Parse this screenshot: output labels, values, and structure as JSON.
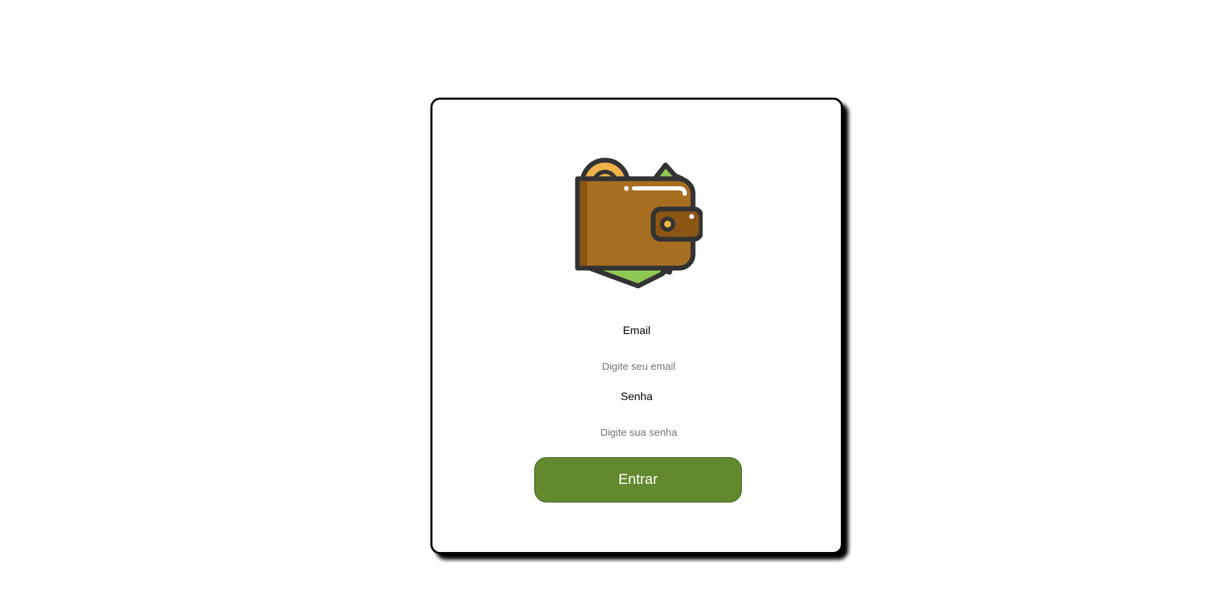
{
  "logo": {
    "icon": "wallet-icon",
    "colors": {
      "wallet": "#a86e22",
      "money": "#8fc754",
      "coin": "#f0b24a",
      "outline": "#333333"
    }
  },
  "form": {
    "email_label": "Email",
    "email_placeholder": "Digite seu email",
    "email_value": "",
    "password_label": "Senha",
    "password_placeholder": "Digite sua senha",
    "password_value": "",
    "submit_label": "Entrar"
  },
  "colors": {
    "accent": "#63892f",
    "card_border": "#000000",
    "background": "#ffffff"
  }
}
